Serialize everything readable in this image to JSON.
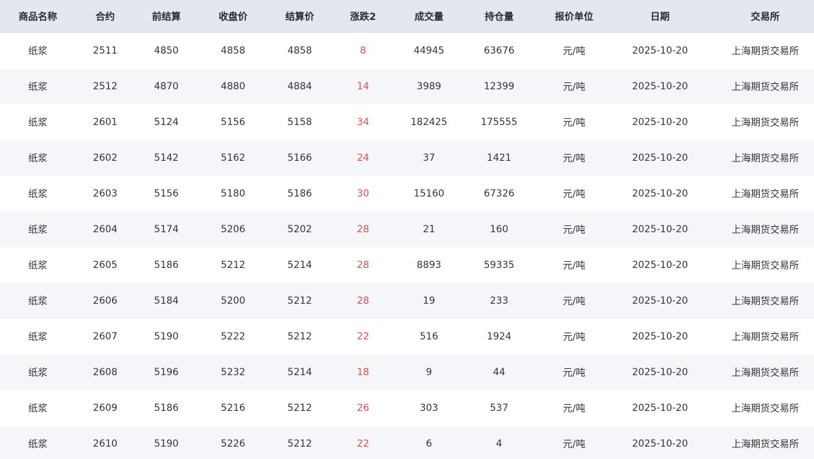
{
  "table": {
    "headers": [
      "商品名称",
      "合约",
      "前结算",
      "收盘价",
      "结算价",
      "涨跌2",
      "成交量",
      "持仓量",
      "报价单位",
      "日期",
      "交易所"
    ],
    "rows": [
      [
        "纸浆",
        "2511",
        "4850",
        "4858",
        "4858",
        "8",
        "44945",
        "63676",
        "元/吨",
        "2025-10-20",
        "上海期货交易所"
      ],
      [
        "纸浆",
        "2512",
        "4870",
        "4880",
        "4884",
        "14",
        "3989",
        "12399",
        "元/吨",
        "2025-10-20",
        "上海期货交易所"
      ],
      [
        "纸浆",
        "2601",
        "5124",
        "5156",
        "5158",
        "34",
        "182425",
        "175555",
        "元/吨",
        "2025-10-20",
        "上海期货交易所"
      ],
      [
        "纸浆",
        "2602",
        "5142",
        "5162",
        "5166",
        "24",
        "37",
        "1421",
        "元/吨",
        "2025-10-20",
        "上海期货交易所"
      ],
      [
        "纸浆",
        "2603",
        "5156",
        "5180",
        "5186",
        "30",
        "15160",
        "67326",
        "元/吨",
        "2025-10-20",
        "上海期货交易所"
      ],
      [
        "纸浆",
        "2604",
        "5174",
        "5206",
        "5202",
        "28",
        "21",
        "160",
        "元/吨",
        "2025-10-20",
        "上海期货交易所"
      ],
      [
        "纸浆",
        "2605",
        "5186",
        "5212",
        "5214",
        "28",
        "8893",
        "59335",
        "元/吨",
        "2025-10-20",
        "上海期货交易所"
      ],
      [
        "纸浆",
        "2606",
        "5184",
        "5200",
        "5212",
        "28",
        "19",
        "233",
        "元/吨",
        "2025-10-20",
        "上海期货交易所"
      ],
      [
        "纸浆",
        "2607",
        "5190",
        "5222",
        "5212",
        "22",
        "516",
        "1924",
        "元/吨",
        "2025-10-20",
        "上海期货交易所"
      ],
      [
        "纸浆",
        "2608",
        "5196",
        "5232",
        "5214",
        "18",
        "9",
        "44",
        "元/吨",
        "2025-10-20",
        "上海期货交易所"
      ],
      [
        "纸浆",
        "2609",
        "5186",
        "5216",
        "5212",
        "26",
        "303",
        "537",
        "元/吨",
        "2025-10-20",
        "上海期货交易所"
      ],
      [
        "纸浆",
        "2610",
        "5190",
        "5226",
        "5212",
        "22",
        "6",
        "4",
        "元/吨",
        "2025-10-20",
        "上海期货交易所"
      ]
    ]
  },
  "colors": {
    "header_bg": "#e4e7ef",
    "row_alt_bg": "#f4f6f9",
    "row_bg": "#ffffff",
    "text": "#333333",
    "change_up": "#e64a4a"
  }
}
